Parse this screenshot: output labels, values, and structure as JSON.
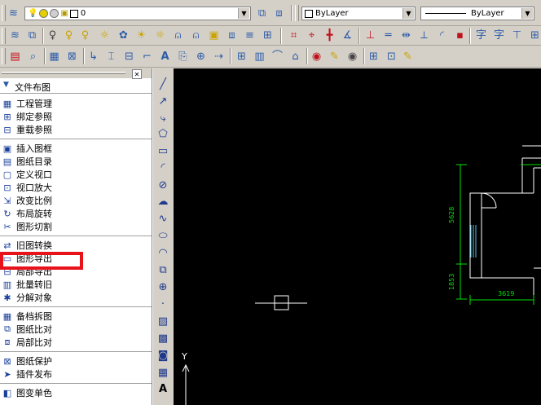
{
  "toolbar_row1": {
    "layer_combo_value": "0",
    "color_combo_value": "ByLayer",
    "linetype_combo_value": "ByLayer"
  },
  "side_panel": {
    "title": "文件布图",
    "groups": [
      [
        {
          "label": "工程管理",
          "icon": "project-icon"
        },
        {
          "label": "绑定参照",
          "icon": "bind-ref-icon"
        },
        {
          "label": "重载参照",
          "icon": "reload-ref-icon"
        }
      ],
      [
        {
          "label": "插入图框",
          "icon": "insert-frame-icon"
        },
        {
          "label": "图纸目录",
          "icon": "catalog-icon"
        },
        {
          "label": "定义视口",
          "icon": "viewport-icon"
        },
        {
          "label": "视口放大",
          "icon": "zoom-viewport-icon"
        },
        {
          "label": "改变比例",
          "icon": "scale-icon"
        },
        {
          "label": "布局旋转",
          "icon": "rotate-icon"
        },
        {
          "label": "图形切割",
          "icon": "cut-icon"
        }
      ],
      [
        {
          "label": "旧图转换",
          "icon": "convert-icon"
        },
        {
          "label": "图形导出",
          "icon": "export-icon"
        },
        {
          "label": "局部导出",
          "icon": "partial-export-icon"
        },
        {
          "label": "批量转旧",
          "icon": "batch-icon"
        },
        {
          "label": "分解对象",
          "icon": "explode-icon"
        }
      ],
      [
        {
          "label": "备档拆图",
          "icon": "archive-icon"
        },
        {
          "label": "图纸比对",
          "icon": "compare-icon"
        },
        {
          "label": "局部比对",
          "icon": "partial-compare-icon"
        }
      ],
      [
        {
          "label": "图纸保护",
          "icon": "protect-icon"
        },
        {
          "label": "插件发布",
          "icon": "publish-icon"
        }
      ],
      [
        {
          "label": "图变单色",
          "icon": "mono-icon"
        }
      ]
    ],
    "highlight_color": "#e8121b"
  },
  "drawing": {
    "dim_width": "3619",
    "dim_height_upper": "5628",
    "dim_height_lower": "1853",
    "axis_y_label": "Y",
    "dim_color": "#00e000"
  }
}
